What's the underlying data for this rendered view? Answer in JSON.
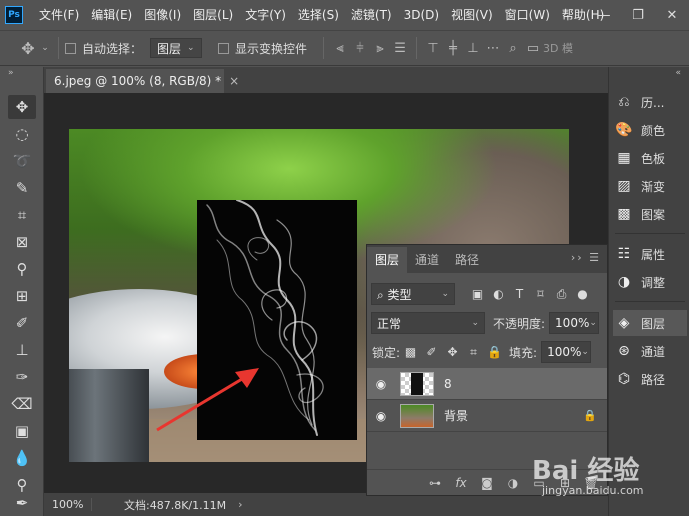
{
  "app": {
    "logo": "Ps"
  },
  "menu": [
    "文件(F)",
    "编辑(E)",
    "图像(I)",
    "图层(L)",
    "文字(Y)",
    "选择(S)",
    "滤镜(T)",
    "3D(D)",
    "视图(V)",
    "窗口(W)",
    "帮助(H)"
  ],
  "window_controls": [
    "—",
    "❐",
    "✕"
  ],
  "options": {
    "auto_select_label": "自动选择：",
    "auto_select_target": "图层",
    "show_transform_label": "显示变换控件",
    "mode_3d": "3D 模"
  },
  "document": {
    "tab_title": "6.jpeg @ 100% (8, RGB/8) *",
    "close": "×"
  },
  "status": {
    "zoom": "100%",
    "doc_info": "文档:487.8K/1.11M",
    "arrow": "›"
  },
  "dock": [
    {
      "label": "历...",
      "icon": "history-icon"
    },
    {
      "label": "颜色",
      "icon": "color-icon"
    },
    {
      "label": "色板",
      "icon": "swatches-icon"
    },
    {
      "label": "渐变",
      "icon": "gradient-icon"
    },
    {
      "label": "图案",
      "icon": "patterns-icon"
    },
    {
      "label": "属性",
      "icon": "properties-icon"
    },
    {
      "label": "调整",
      "icon": "adjustments-icon"
    },
    {
      "label": "图层",
      "icon": "layers-icon"
    },
    {
      "label": "通道",
      "icon": "channels-icon"
    },
    {
      "label": "路径",
      "icon": "paths-icon"
    }
  ],
  "layers_panel": {
    "tabs": [
      "图层",
      "通道",
      "路径"
    ],
    "filter_type": "类型",
    "blend_mode": "正常",
    "opacity_label": "不透明度:",
    "opacity_value": "100%",
    "lock_label": "锁定:",
    "fill_label": "填充:",
    "fill_value": "100%",
    "layers": [
      {
        "name": "8",
        "selected": true,
        "locked": false
      },
      {
        "name": "背景",
        "selected": false,
        "locked": true
      }
    ]
  },
  "watermark": {
    "logo_text": "Bai 经验",
    "url": "jingyan.baidu.com"
  },
  "colors": {
    "ui_bg": "#535353",
    "canvas_bg": "#282828",
    "arrow": "#e8362f",
    "accent": "#31a8ff"
  }
}
